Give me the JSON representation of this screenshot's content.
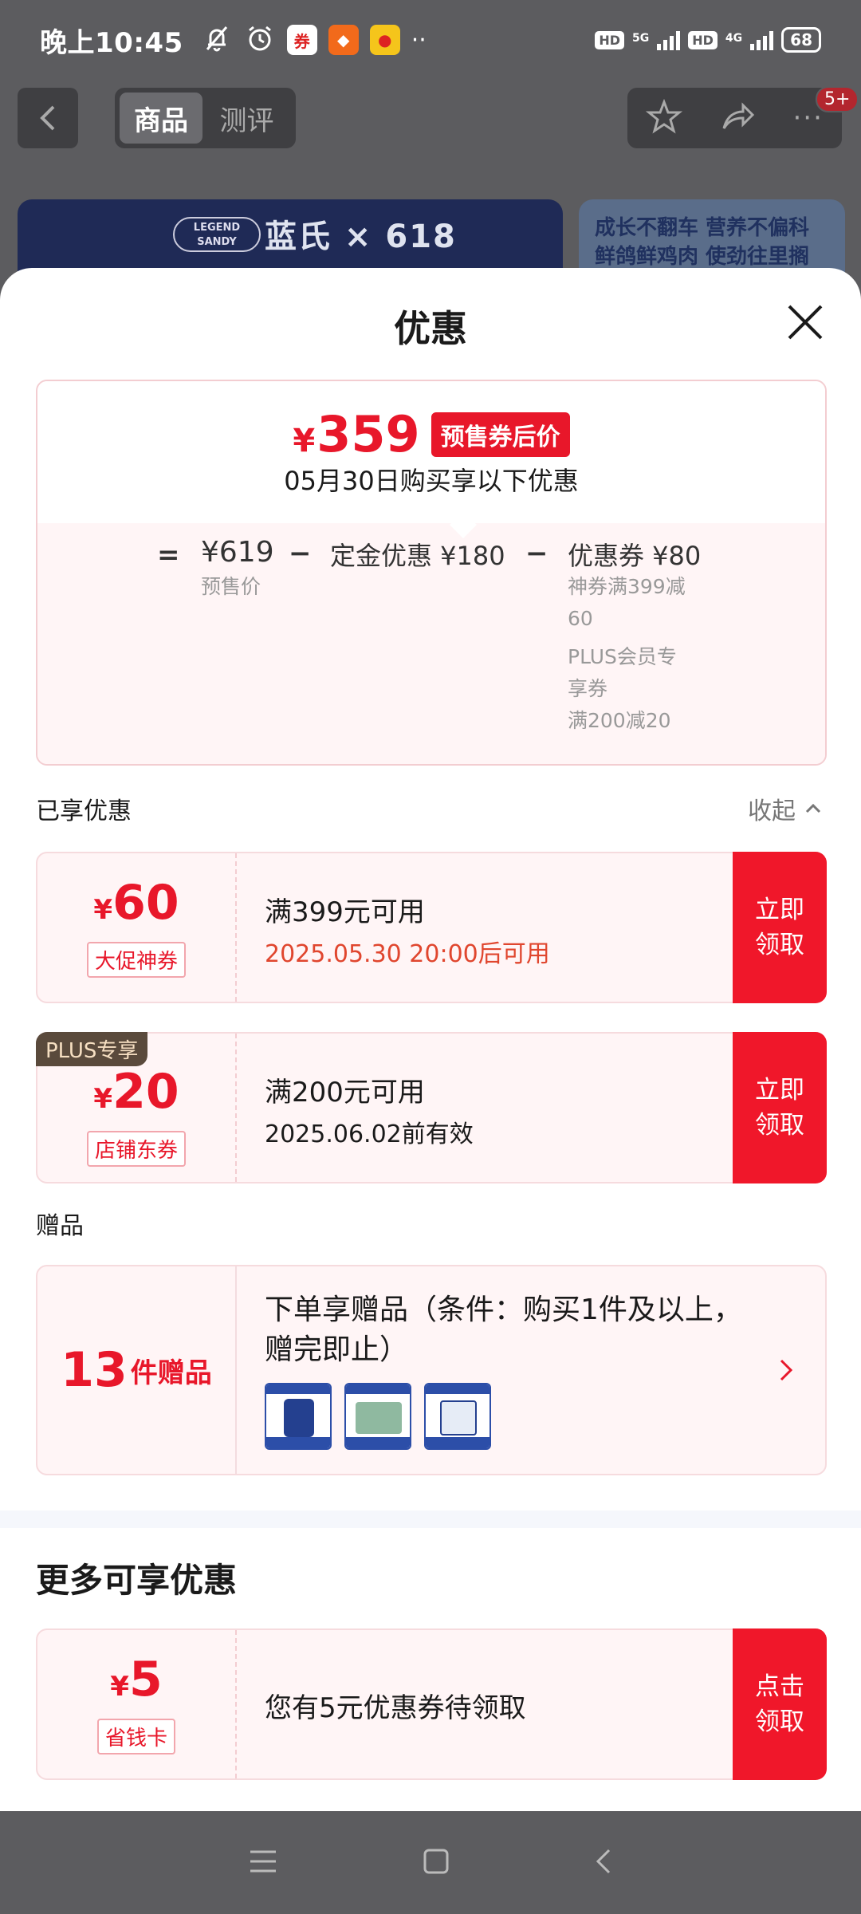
{
  "status_bar": {
    "time": "晚上10:45",
    "signal_1": "5G",
    "signal_2": "4G",
    "hd": "HD",
    "battery": "68"
  },
  "top_nav": {
    "tab_active": "商品",
    "tab_inactive": "测评",
    "badge": "5+"
  },
  "background": {
    "brand_legend": "LEGEND SANDY",
    "brand_text": "蓝氏 × 618",
    "promo_line1": "成长不翻车 营养不偏科",
    "promo_line2": "鲜鸽鲜鸡肉 使劲往里搁"
  },
  "sheet": {
    "title": "优惠"
  },
  "summary": {
    "currency": "¥",
    "final_price": "359",
    "final_tag": "预售券后价",
    "buy_date": "05月30日购买享以下优惠",
    "equals": "=",
    "presale_price": "¥619",
    "presale_label": "预售价",
    "minus": "−",
    "deposit_label": "定金优惠 ¥180",
    "coupon_label": "优惠券 ¥80",
    "coupon_detail_1a": "神券满399减",
    "coupon_detail_1b": "60",
    "coupon_detail_2a": "PLUS会员专",
    "coupon_detail_2b": "享券",
    "coupon_detail_3": "满200减20"
  },
  "enjoyed": {
    "label": "已享优惠",
    "collapse": "收起"
  },
  "coupons": [
    {
      "currency": "¥",
      "amount": "60",
      "tag": "大促神券",
      "condition": "满399元可用",
      "validity": "2025.05.30 20:00后可用",
      "button": "立即领取"
    },
    {
      "plus_tag": "PLUS专享",
      "currency": "¥",
      "amount": "20",
      "tag": "店铺东券",
      "condition": "满200元可用",
      "validity": "2025.06.02前有效",
      "button": "立即领取"
    }
  ],
  "gifts": {
    "label": "赠品",
    "count": "13",
    "unit": "件赠品",
    "description": "下单享赠品（条件：购买1件及以上，赠完即止）"
  },
  "more": {
    "title": "更多可享优惠",
    "currency": "¥",
    "amount": "5",
    "tag": "省钱卡",
    "text": "您有5元优惠券待领取",
    "button": "点击领取"
  },
  "colors": {
    "accent": "#e8172a",
    "coupon_bg": "#fff5f6",
    "plus_tag_bg": "#5a4a3c"
  }
}
